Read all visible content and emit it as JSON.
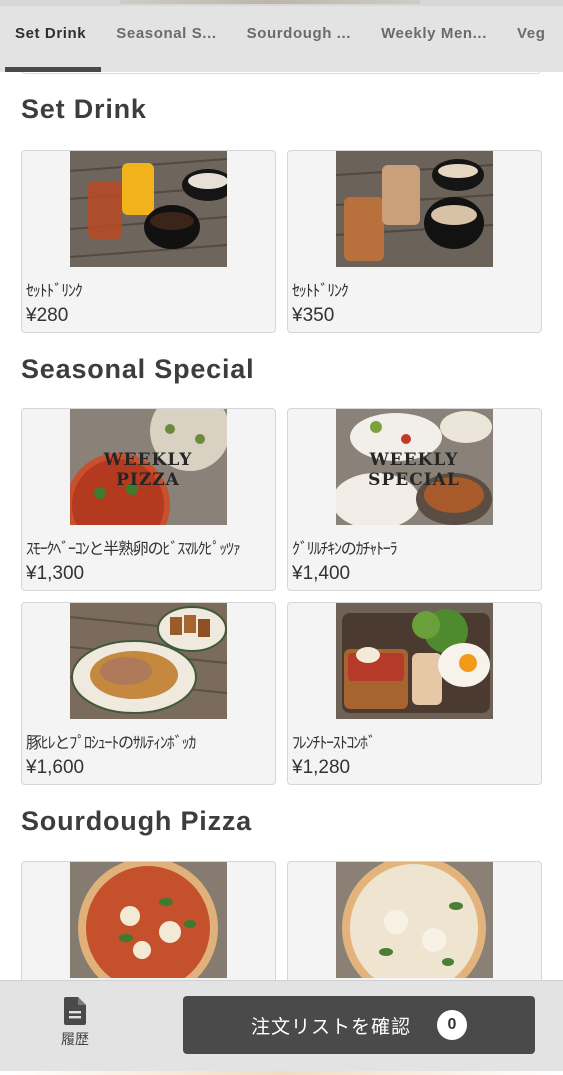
{
  "tabs": [
    {
      "label": "Set Drink",
      "active": true
    },
    {
      "label": "Seasonal S...",
      "active": false
    },
    {
      "label": "Sourdough ...",
      "active": false
    },
    {
      "label": "Weekly Men...",
      "active": false
    },
    {
      "label": "Veg",
      "active": false
    }
  ],
  "sections": [
    {
      "title": "Set Drink",
      "items": [
        {
          "name": "ｾｯﾄﾄﾞﾘﾝｸ",
          "price": "¥280",
          "icon": "iced-tea-and-coffee-photo"
        },
        {
          "name": "ｾｯﾄﾄﾞﾘﾝｸ",
          "price": "¥350",
          "icon": "iced-latte-and-coffee-photo"
        }
      ]
    },
    {
      "title": "Seasonal Special",
      "items": [
        {
          "name": "ｽﾓｰｸﾍﾞｰｺﾝと半熟卵のﾋﾞｽﾏﾙｸﾋﾟｯﾂｧ",
          "price": "¥1,300",
          "icon": "weekly-pizza-photo",
          "overlay": "WEEKLY\nPIZZA"
        },
        {
          "name": "ｸﾞﾘﾙﾁｷﾝのｶﾁｬﾄｰﾗ",
          "price": "¥1,400",
          "icon": "weekly-special-photo",
          "overlay": "WEEKLY\nSPECIAL"
        },
        {
          "name": "豚ﾋﾚとﾌﾟﾛｼｭｰﾄのｻﾙﾃｨﾝﾎﾞｯｶ",
          "price": "¥1,600",
          "icon": "saltimbocca-photo"
        },
        {
          "name": "ﾌﾚﾝﾁﾄｰｽﾄｺﾝﾎﾞ",
          "price": "¥1,280",
          "icon": "french-toast-photo"
        }
      ]
    },
    {
      "title": "Sourdough Pizza",
      "items": [
        {
          "name": "",
          "price": "",
          "icon": "margherita-pizza-photo"
        },
        {
          "name": "",
          "price": "",
          "icon": "bianca-pizza-photo"
        }
      ]
    }
  ],
  "bottom": {
    "history_label": "履歴",
    "order_button_label": "注文リストを確認",
    "order_count": "0"
  },
  "colors": {
    "tab_bar": "#e3e3e3",
    "active_indicator": "#4a4a4a",
    "card_bg": "#f4f4f4",
    "order_button": "#4a4a4a"
  }
}
